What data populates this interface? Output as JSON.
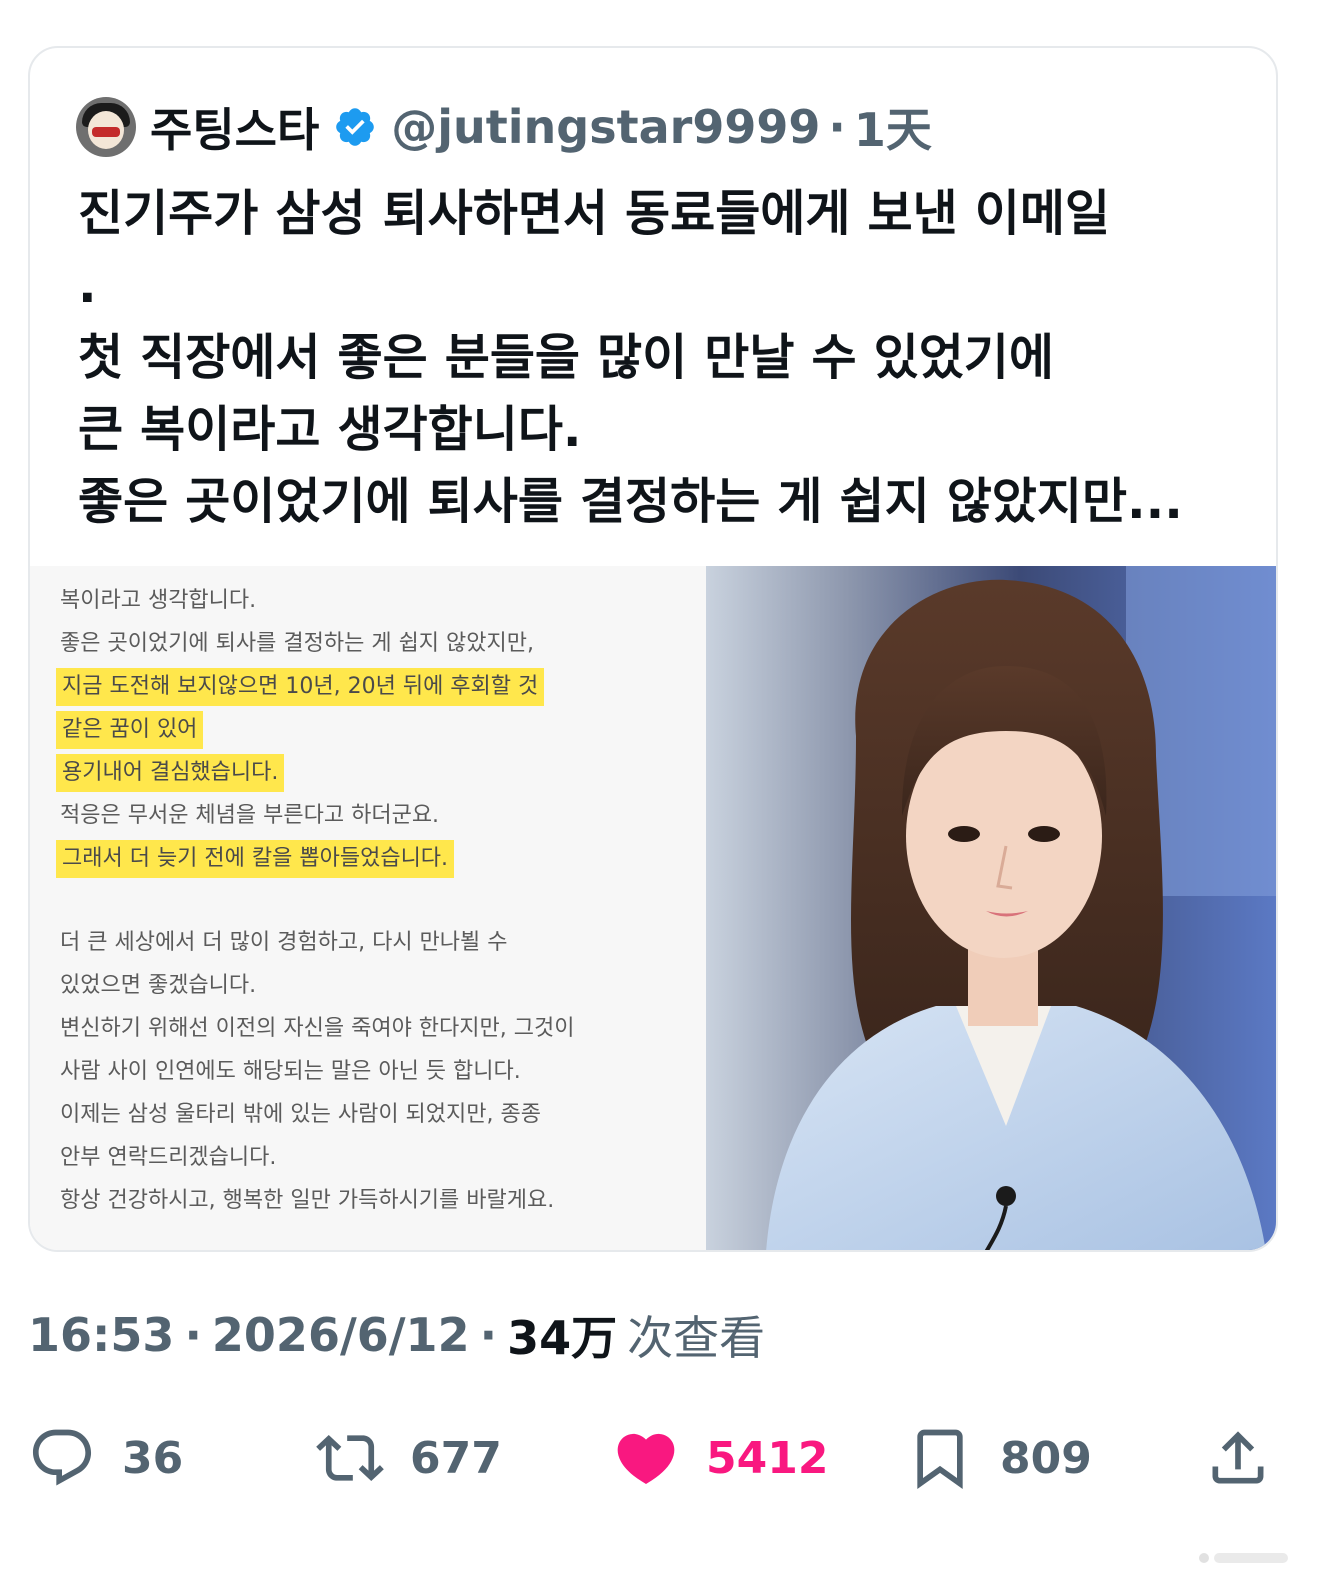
{
  "quote": {
    "author_name": "주팅스타",
    "handle": "@jutingstar9999",
    "separator": "·",
    "time": "1天",
    "text": "진기주가 삼성 퇴사하면서 동료들에게 보낸 이메일\n.\n첫 직장에서 좋은 분들을 많이 만날 수 있었기에\n큰 복이라고 생각합니다.\n좋은 곳이었기에 퇴사를 결정하는 게 쉽지 않았지만..."
  },
  "email_image": {
    "lines": [
      "복이라고 생각합니다.",
      "좋은 곳이었기에 퇴사를 결정하는 게 쉽지 않았지만,",
      "지금 도전해 보지않으면 10년, 20년 뒤에 후회할 것",
      "같은 꿈이 있어",
      "용기내어 결심했습니다.",
      "적응은 무서운 체념을 부른다고 하더군요.",
      "그래서 더 늦기 전에 칼을 뽑아들었습니다.",
      "더 큰 세상에서 더 많이 경험하고, 다시 만나뵐 수",
      "있었으면 좋겠습니다.",
      "변신하기 위해선 이전의 자신을 죽여야 한다지만, 그것이",
      "사람 사이 인연에도 해당되는 말은 아닌 듯 합니다.",
      "이제는 삼성 울타리 밖에 있는 사람이 되었지만, 종종",
      "안부 연락드리겠습니다.",
      "항상 건강하시고, 행복한 일만 가득하시기를 바랄게요."
    ]
  },
  "meta": {
    "time": "16:53",
    "sep1": "·",
    "date": "2026/6/12",
    "sep2": "·",
    "views_count": "34万",
    "views_label": "次查看"
  },
  "actions": {
    "replies": "36",
    "reposts": "677",
    "likes": "5412",
    "bookmarks": "809"
  },
  "colors": {
    "text_primary": "#0f1419",
    "text_secondary": "#536471",
    "verified_blue": "#1d9bf0",
    "like_pink": "#f91880",
    "highlight_yellow": "#ffe74c"
  },
  "icons": [
    "verified-badge-icon",
    "reply-icon",
    "repost-icon",
    "heart-icon",
    "bookmark-icon",
    "share-icon"
  ]
}
